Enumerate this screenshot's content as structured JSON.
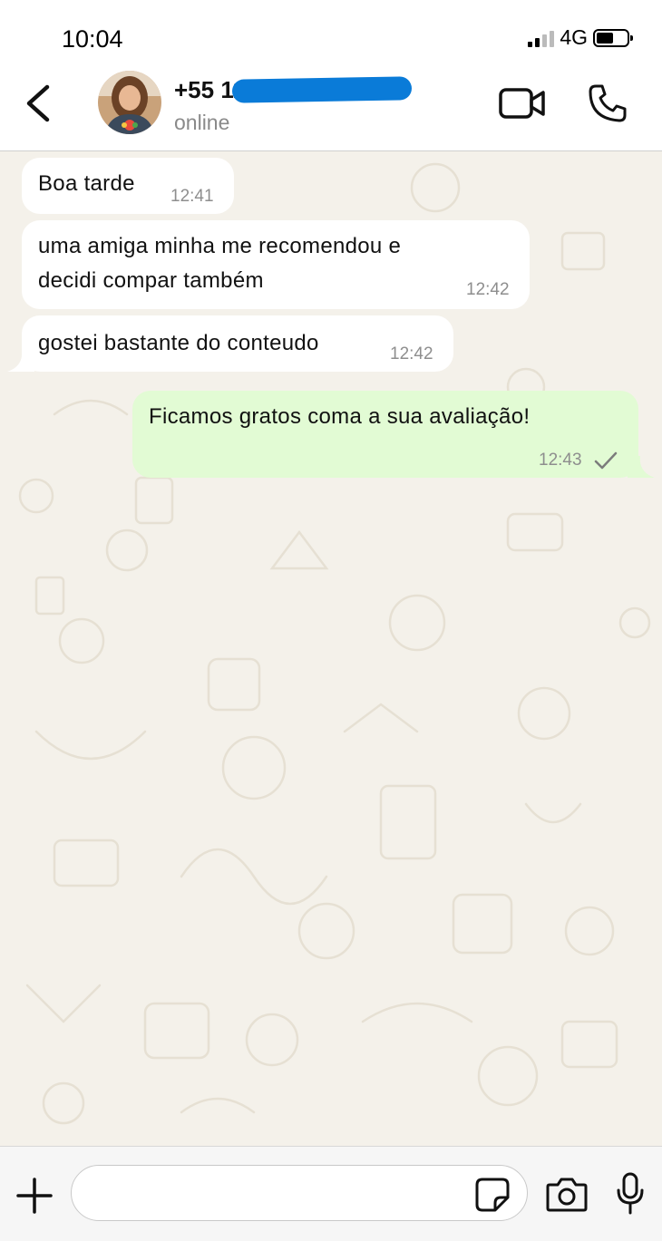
{
  "status": {
    "time": "10:04",
    "network": "4G"
  },
  "header": {
    "contact_name": "+55 11",
    "presence": "online"
  },
  "messages": [
    {
      "direction": "in",
      "text_lines": [
        "Boa tarde"
      ],
      "time": "12:41"
    },
    {
      "direction": "in",
      "text_lines": [
        "uma amiga minha me recomendou e",
        "decidi compar também"
      ],
      "time": "12:42"
    },
    {
      "direction": "in",
      "text_lines": [
        "gostei bastante do conteudo"
      ],
      "time": "12:42"
    },
    {
      "direction": "out",
      "text_lines": [
        "Ficamos gratos coma a sua avaliação!"
      ],
      "time": "12:43",
      "status": "sent"
    }
  ],
  "composer": {
    "placeholder": ""
  },
  "colors": {
    "incoming_bubble": "#ffffff",
    "outgoing_bubble": "#e2fbd4",
    "chat_background": "#f4f1ea",
    "redaction": "#0a7bd8"
  },
  "icons": [
    "back-chevron-icon",
    "video-call-icon",
    "phone-call-icon",
    "plus-icon",
    "sticker-icon",
    "camera-icon",
    "microphone-icon",
    "single-check-icon"
  ]
}
